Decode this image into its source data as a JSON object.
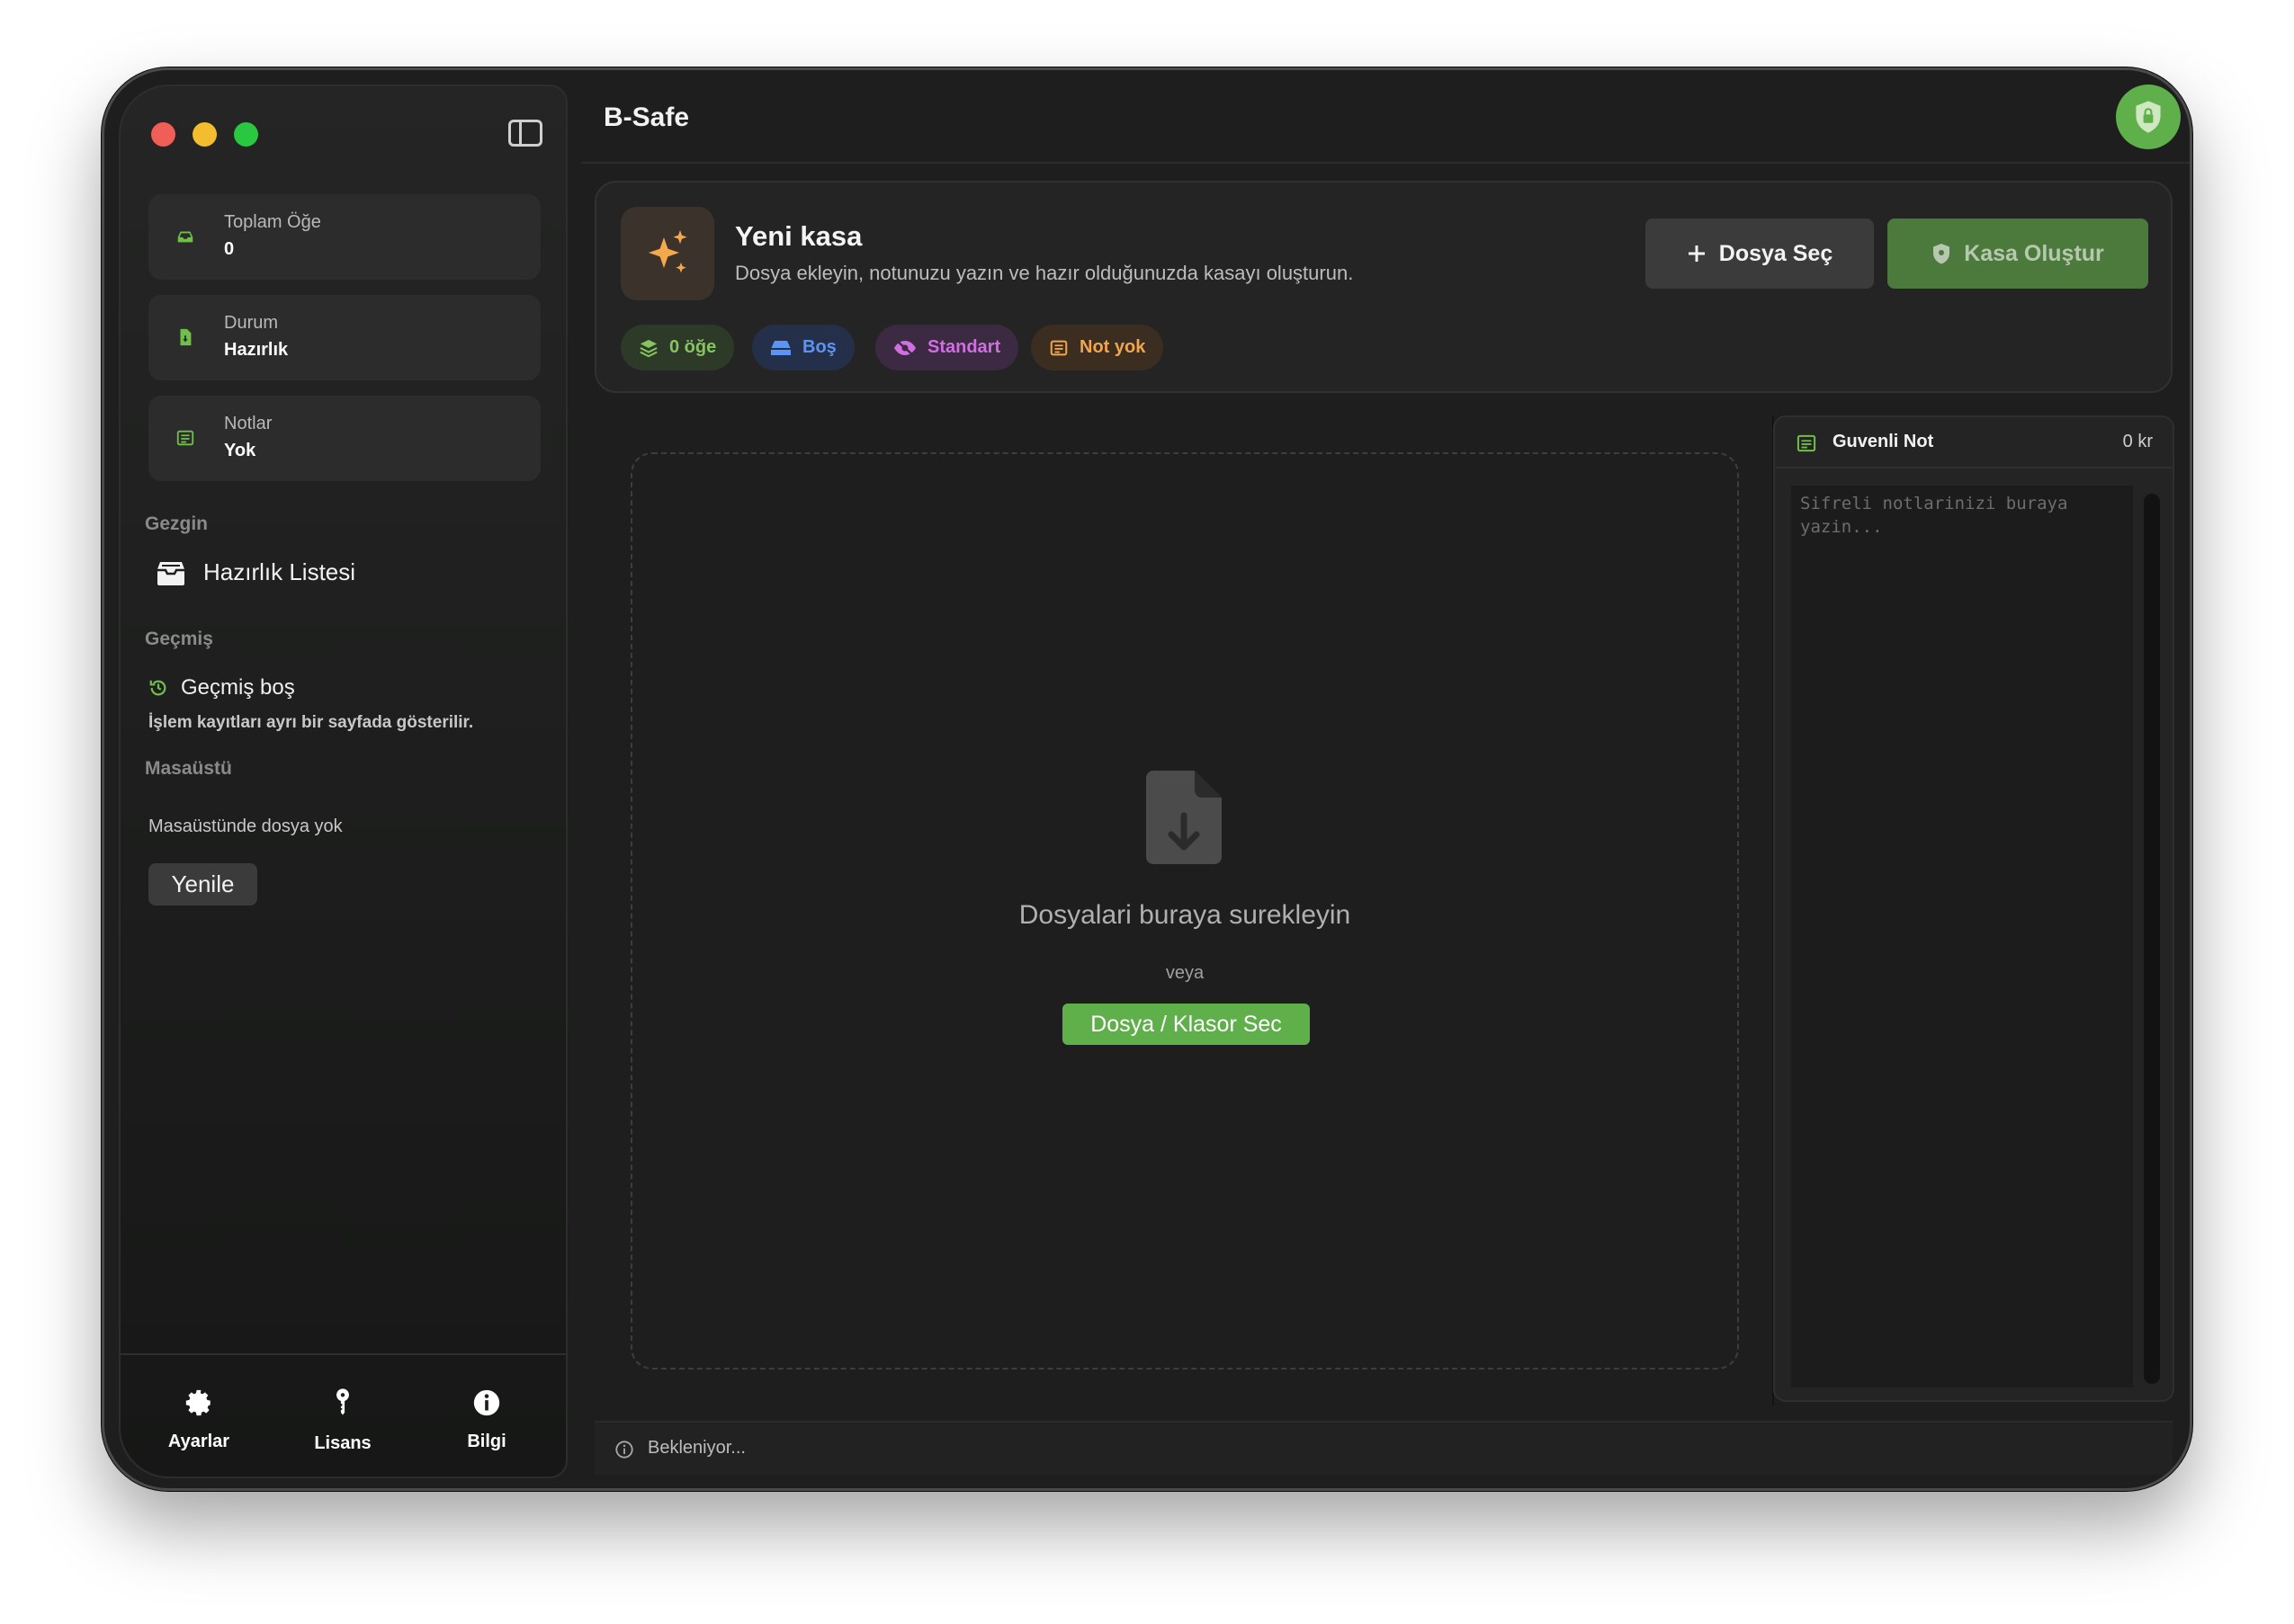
{
  "app": {
    "title": "B-Safe"
  },
  "sidebar": {
    "stats": [
      {
        "label": "Toplam Öğe",
        "value": "0"
      },
      {
        "label": "Durum",
        "value": "Hazırlık"
      },
      {
        "label": "Notlar",
        "value": "Yok"
      }
    ],
    "sections": {
      "explorer": "Gezgin",
      "history": "Geçmiş",
      "desktop": "Masaüstü"
    },
    "nav_item": "Hazırlık Listesi",
    "history_empty": "Geçmiş boş",
    "history_sub": "İşlem kayıtları ayrı bir sayfada gösterilir.",
    "desktop_empty": "Masaüstünde dosya yok",
    "refresh_label": "Yenile",
    "footer": [
      {
        "label": "Ayarlar",
        "icon": "gear-icon"
      },
      {
        "label": "Lisans",
        "icon": "key-icon"
      },
      {
        "label": "Bilgi",
        "icon": "info-icon"
      }
    ]
  },
  "vault": {
    "title": "Yeni kasa",
    "subtitle": "Dosya ekleyin, notunuzu yazın ve hazır olduğunuzda kasayı oluşturun.",
    "select_file": "Dosya Seç",
    "create": "Kasa Oluştur",
    "pills": {
      "items": "0 öğe",
      "empty": "Boş",
      "standard": "Standart",
      "note": "Not yok"
    }
  },
  "dropzone": {
    "title": "Dosyalari buraya surekleyin",
    "or": "veya",
    "button": "Dosya / Klasor Sec"
  },
  "note": {
    "title": "Guvenli Not",
    "count": "0 kr",
    "placeholder": "Sifreli notlarinizi buraya yazin..."
  },
  "status": {
    "text": "Bekleniyor..."
  },
  "colors": {
    "accent_green": "#5fb04a",
    "pill_green": "#86c45f",
    "pill_blue": "#5b94f2",
    "pill_purple": "#d06fe0",
    "pill_orange": "#f2a54a"
  }
}
